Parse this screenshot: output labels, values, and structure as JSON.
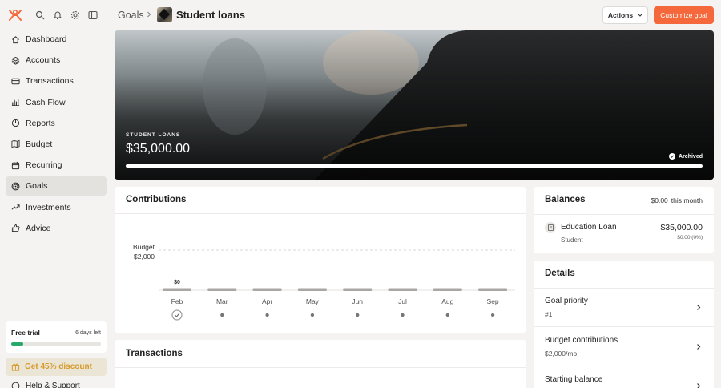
{
  "sidebar": {
    "items": [
      {
        "label": "Dashboard",
        "icon": "home-icon"
      },
      {
        "label": "Accounts",
        "icon": "layers-icon"
      },
      {
        "label": "Transactions",
        "icon": "credit-card-icon"
      },
      {
        "label": "Cash Flow",
        "icon": "bar-chart-icon"
      },
      {
        "label": "Reports",
        "icon": "pie-chart-icon"
      },
      {
        "label": "Budget",
        "icon": "map-icon"
      },
      {
        "label": "Recurring",
        "icon": "calendar-icon"
      },
      {
        "label": "Goals",
        "icon": "target-icon",
        "active": true
      },
      {
        "label": "Investments",
        "icon": "trend-up-icon"
      },
      {
        "label": "Advice",
        "icon": "thumbs-up-icon"
      }
    ],
    "trial": {
      "title": "Free trial",
      "days_left": "6 days left",
      "progress": 0.13
    },
    "discount": "Get 45% discount",
    "help": "Help & Support"
  },
  "header": {
    "breadcrumb_root": "Goals",
    "title": "Student loans",
    "actions_label": "Actions",
    "customize_label": "Customize goal"
  },
  "hero": {
    "label": "STUDENT LOANS",
    "amount": "$35,000.00",
    "status": "Archived",
    "progress": 1.0
  },
  "contributions": {
    "title": "Contributions",
    "budget_label": "Budget",
    "budget_value": "$2,000",
    "chart_data": {
      "type": "bar",
      "categories": [
        "Feb",
        "Mar",
        "Apr",
        "May",
        "Jun",
        "Jul",
        "Aug",
        "Sep"
      ],
      "values": [
        0,
        0,
        0,
        0,
        0,
        0,
        0,
        0
      ],
      "data_labels": [
        "$0",
        "",
        "",
        "",
        "",
        "",
        "",
        ""
      ],
      "budget_line": 2000,
      "ylim": [
        0,
        2000
      ],
      "completed_months": [
        "Feb"
      ]
    }
  },
  "balances": {
    "title": "Balances",
    "month_amount": "$0.00",
    "month_label": "this month",
    "account": {
      "name": "Education Loan",
      "type": "Student",
      "amount": "$35,000.00",
      "change": "$0.00 (0%)"
    }
  },
  "details": {
    "title": "Details",
    "rows": [
      {
        "label": "Goal priority",
        "value": "#1"
      },
      {
        "label": "Budget contributions",
        "value": "$2,000/mo"
      },
      {
        "label": "Starting balance",
        "value": ""
      }
    ]
  },
  "transactions": {
    "title": "Transactions"
  },
  "colors": {
    "accent": "#f4683c",
    "success": "#28a86a",
    "discount": "#d69a2b"
  }
}
